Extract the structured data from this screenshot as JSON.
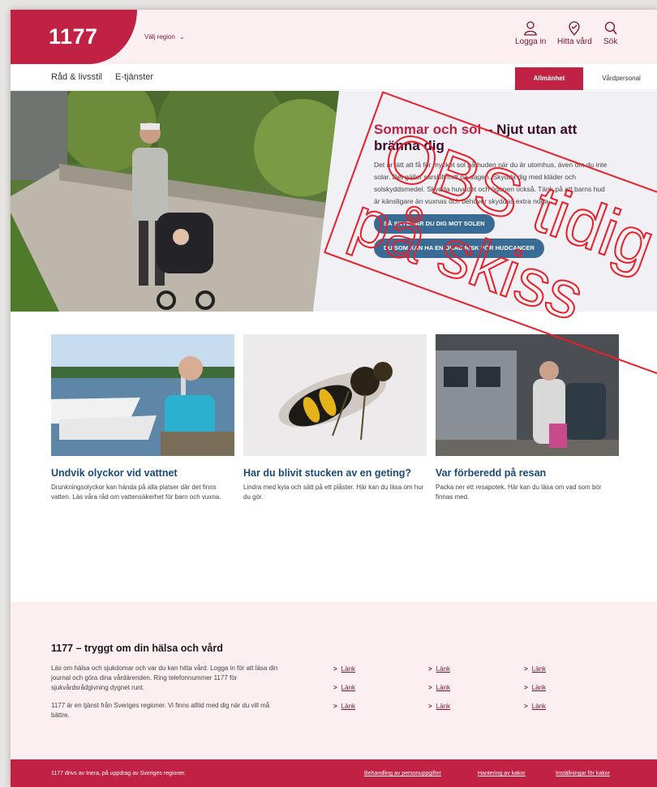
{
  "header": {
    "logo_text": "1177",
    "region_label": "Välj region",
    "login_label": "Logga in",
    "find_care_label": "Hitta vård",
    "search_label": "Sök"
  },
  "nav": {
    "link1": "Råd & livsstil",
    "link2": "E-tjänster",
    "tab_public": "Allmänhet",
    "tab_pro": "Vårdpersonal"
  },
  "hero": {
    "title_accent": "Sommar och sol",
    "title_rest": " – Njut utan att bränna dig",
    "body": "Det är lätt att få för mycket sol på huden när du är utomhus, även om du inte solar. Det gäller särskilt mitt på dagen. Skydda dig med kläder och solskyddsmedel. Skydda huvudet och ögonen också. Tänk på att barns hud är känsligare än vuxnas och behöver skyddas extra noga.",
    "button1": "SÅ SKYDDAR DU DIG MOT SOLEN",
    "button2": "DU SOM KAN HA EN ÖKAD RISK FÖR HUDCANCER"
  },
  "cards": [
    {
      "title": "Undvik olyckor vid vattnet",
      "body": "Drunkningsolyckor kan hända på alla platser där det finns vatten. Läs våra råd om vattensäkerhet för barn och vuxna."
    },
    {
      "title": "Har du blivit stucken av en geting?",
      "body": "Lindra med kyla och sätt på ett plåster. Här kan du läsa om hur du gör."
    },
    {
      "title": "Var förberedd på resan",
      "body": "Packa ner ett resapotek. Här kan du läsa om vad som bör finnas med."
    }
  ],
  "footer_info": {
    "title": "1177 – tryggt om din hälsa och vård",
    "p1": "Läs om hälsa och sjukdomar och var du kan hitta vård. Logga in för att läsa din journal och göra dina vårdärenden. Ring telefonnummer 1177 för sjukvårdsrådgivning dygnet runt.",
    "p2": "1177 är en tjänst från Sveriges regioner. Vi finns alltid med dig när du vill må bättre.",
    "link_label": "Länk"
  },
  "bottom_bar": {
    "text": "1177 drivs av Inera, på uppdrag av Sveriges regioner.",
    "link1": "Behandling av personuppgifter",
    "link2": "Hantering av kakor",
    "link3": "Inställningar för kakor"
  },
  "stamp": {
    "line1": "OBS tidig",
    "line2": "på skiss"
  },
  "colors": {
    "brand_red": "#c12143",
    "dark_plum": "#3b0a2a",
    "link_blue": "#1a4a79",
    "button_blue": "#396b95",
    "pink_bg": "#fbeff2"
  }
}
